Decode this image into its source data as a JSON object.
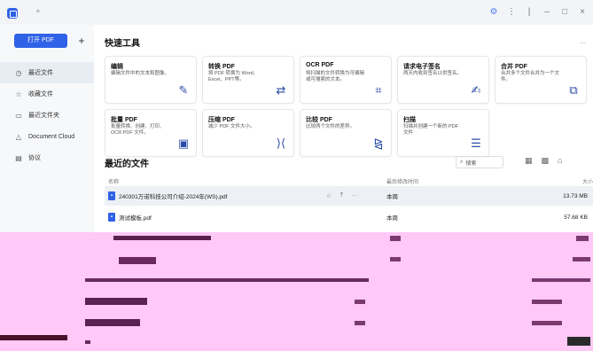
{
  "window": {
    "new_tab_label": "+",
    "controls": [
      "⚙",
      "⋮",
      "|",
      "–",
      "□",
      "×"
    ]
  },
  "sidebar": {
    "open_pdf_label": "打开 PDF",
    "new_label": "+",
    "items": [
      {
        "label": "最近文件",
        "icon": "clock-icon"
      },
      {
        "label": "收藏文件",
        "icon": "star-icon"
      },
      {
        "label": "最近文件夹",
        "icon": "folder-icon"
      },
      {
        "label": "Document Cloud",
        "icon": "cloud-icon"
      },
      {
        "label": "协议",
        "icon": "document-icon"
      }
    ]
  },
  "main": {
    "quick_tools_title": "快速工具",
    "more": "...",
    "tools": [
      {
        "title": "编辑",
        "desc": "编辑文件中的文本和图像。",
        "icon": "edit-icon"
      },
      {
        "title": "转换 PDF",
        "desc": "将 PDF 转换为 Word、Excel、PPT等。",
        "icon": "convert-icon"
      },
      {
        "title": "OCR PDF",
        "desc": "将扫描的文件转换为可编辑或可搜索的文本。",
        "icon": "ocr-icon"
      },
      {
        "title": "请求电子签名",
        "desc": "两天内收到签名以供签名。",
        "icon": "signature-icon"
      },
      {
        "title": "合并 PDF",
        "desc": "合并多个文件合并为一个文件。",
        "icon": "merge-icon"
      },
      {
        "title": "批量 PDF",
        "desc": "批量转换、创建、打印、OCR PDF 文件。",
        "icon": "batch-icon"
      },
      {
        "title": "压缩 PDF",
        "desc": "减少 PDF 文件大小。",
        "icon": "compress-icon"
      },
      {
        "title": "比较 PDF",
        "desc": "比较两个文件的差异。",
        "icon": "compare-icon"
      },
      {
        "title": "扫描",
        "desc": "扫描并创建一个新的 PDF 文件",
        "icon": "scan-icon"
      }
    ],
    "recent_title": "最近的文件",
    "search_placeholder": "搜索",
    "columns": {
      "name": "名称",
      "modified": "最后修改时间",
      "size": "大小"
    },
    "files": [
      {
        "name": "240301万诺科技公司介绍-2024年(WS).pdf",
        "date": "本周",
        "size": "13.73 MB"
      },
      {
        "name": "测试模板.pdf",
        "date": "本周",
        "size": "57.68 KB"
      }
    ],
    "hover_actions": [
      "☆",
      "⤒",
      "···"
    ]
  },
  "colors": {
    "accent": "#2f62e6",
    "glitch": "#ffc8f6"
  }
}
